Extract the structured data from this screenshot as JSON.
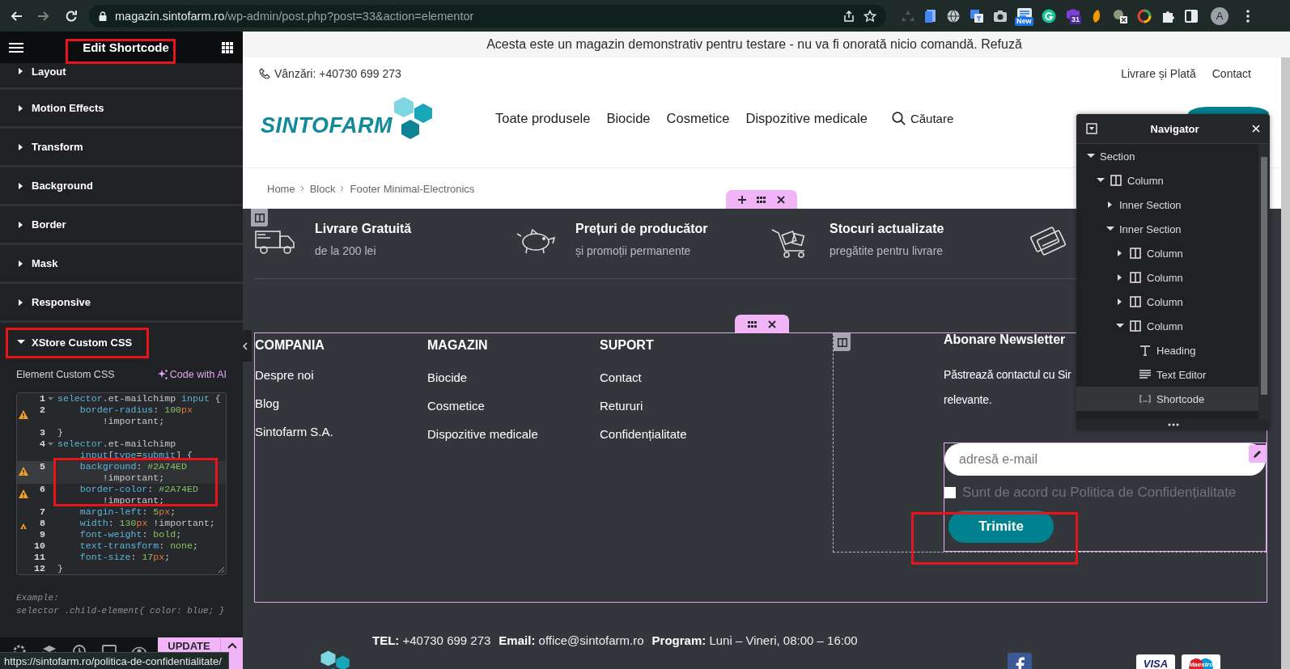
{
  "browser": {
    "url_host": "magazin.sintofarm.ro",
    "url_path": "/wp-admin/post.php?post=33&action=elementor",
    "new_badge": "New",
    "calendar_badge": "31",
    "profile_initial": "A"
  },
  "editor": {
    "title": "Edit Shortcode",
    "sections": [
      {
        "label": "Layout",
        "expanded": false
      },
      {
        "label": "Motion Effects",
        "expanded": false
      },
      {
        "label": "Transform",
        "expanded": false
      },
      {
        "label": "Background",
        "expanded": false
      },
      {
        "label": "Border",
        "expanded": false
      },
      {
        "label": "Mask",
        "expanded": false
      },
      {
        "label": "Responsive",
        "expanded": false
      },
      {
        "label": "XStore Custom CSS",
        "expanded": true
      }
    ],
    "custom_css": {
      "label": "Element Custom CSS",
      "ai_link": "Code with AI",
      "lines": [
        {
          "number": "1",
          "fold": true,
          "warning": false,
          "current": false,
          "rows": [
            "selector.et-mailchimp input {"
          ]
        },
        {
          "number": "2",
          "fold": false,
          "warning": true,
          "current": false,
          "rows": [
            "    border-radius: 100px",
            "        !important;"
          ]
        },
        {
          "number": "3",
          "fold": false,
          "warning": false,
          "current": false,
          "rows": [
            "}"
          ]
        },
        {
          "number": "4",
          "fold": true,
          "warning": false,
          "current": false,
          "rows": [
            "selector.et-mailchimp",
            "    input[type=submit] {"
          ]
        },
        {
          "number": "5",
          "fold": false,
          "warning": true,
          "current": true,
          "rows": [
            "    background: #2A74ED",
            "        !important;"
          ]
        },
        {
          "number": "6",
          "fold": false,
          "warning": true,
          "current": false,
          "rows": [
            "    border-color: #2A74ED",
            "        !important;"
          ]
        },
        {
          "number": "7",
          "fold": false,
          "warning": false,
          "current": false,
          "rows": [
            "    margin-left: 5px;"
          ]
        },
        {
          "number": "8",
          "fold": false,
          "warning": true,
          "current": false,
          "rows": [
            "    width: 130px !important;"
          ]
        },
        {
          "number": "9",
          "fold": false,
          "warning": false,
          "current": false,
          "rows": [
            "    font-weight: bold;"
          ]
        },
        {
          "number": "10",
          "fold": false,
          "warning": false,
          "current": false,
          "rows": [
            "    text-transform: none;"
          ]
        },
        {
          "number": "11",
          "fold": false,
          "warning": false,
          "current": false,
          "rows": [
            "    font-size: 17px;"
          ]
        },
        {
          "number": "12",
          "fold": false,
          "warning": false,
          "current": false,
          "rows": [
            "}"
          ]
        }
      ],
      "example_label": "Example:",
      "example_code": "selector .child-element{ color: blue; }"
    },
    "update_button": "UPDATE"
  },
  "site": {
    "notice": "Acesta este un magazin demonstrativ pentru testare - nu va fi onorată nicio comandă. Refuză",
    "phone": "Vânzări: +40730 699 273",
    "top_links": [
      "Livrare și Plată",
      "Contact"
    ],
    "logo_text": "SINTOFARM",
    "menu": [
      "Toate produsele",
      "Biocide",
      "Cosmetice",
      "Dispozitive medicale"
    ],
    "search_label": "Căutare",
    "breadcrumb": [
      "Home",
      "Block",
      "Footer Minimal-Electronics"
    ],
    "features": [
      {
        "kind": "truck",
        "title": "Livrare Gratuită",
        "subtitle": "de la 200 lei"
      },
      {
        "kind": "piggy",
        "title": "Prețuri de producător",
        "subtitle": "și promoții permanente"
      },
      {
        "kind": "cart",
        "title": "Stocuri actualizate",
        "subtitle": "pregătite pentru livrare"
      },
      {
        "kind": "cards"
      }
    ],
    "link_columns": [
      {
        "heading": "COMPANIA",
        "links": [
          "Despre noi",
          "Blog",
          "Sintofarm S.A."
        ]
      },
      {
        "heading": "MAGAZIN",
        "links": [
          "Biocide",
          "Cosmetice",
          "Dispozitive medicale"
        ]
      },
      {
        "heading": "SUPORT",
        "links": [
          "Contact",
          "Retururi",
          "Confidențialitate"
        ]
      }
    ],
    "newsletter": {
      "heading": "Abonare Newsletter",
      "text_lines": [
        "Păstrează contactul cu Sir",
        "relevante."
      ],
      "email_placeholder": "adresă e-mail",
      "consent": {
        "label": "Sunt de acord cu Politica de Confidențialitate",
        "checked": false
      },
      "submit": "Trimite"
    },
    "contact": [
      "**TEL:** +40730 699 273",
      "**Email:** office@sintofarm.ro",
      "**Program:** Luni – Vineri, 08:00 – 16:00"
    ],
    "payment_cards": [
      "VISA",
      "Maestro"
    ]
  },
  "navigator": {
    "title": "Navigator",
    "tree": [
      {
        "kind": "section",
        "label": "Section",
        "expanded": true,
        "selected": false,
        "children": [
          {
            "kind": "column",
            "label": "Column",
            "expanded": true,
            "selected": false,
            "children": [
              {
                "kind": "inner_section",
                "label": "Inner Section",
                "expanded": false,
                "selected": false
              },
              {
                "kind": "inner_section",
                "label": "Inner Section",
                "expanded": true,
                "selected": false,
                "children": [
                  {
                    "kind": "column",
                    "label": "Column",
                    "expanded": false,
                    "selected": false
                  },
                  {
                    "kind": "column",
                    "label": "Column",
                    "expanded": false,
                    "selected": false
                  },
                  {
                    "kind": "column",
                    "label": "Column",
                    "expanded": false,
                    "selected": false
                  },
                  {
                    "kind": "column",
                    "label": "Column",
                    "expanded": true,
                    "selected": false,
                    "children": [
                      {
                        "kind": "heading",
                        "label": "Heading",
                        "selected": false
                      },
                      {
                        "kind": "text_editor",
                        "label": "Text Editor",
                        "selected": false
                      },
                      {
                        "kind": "shortcode",
                        "label": "Shortcode",
                        "selected": true
                      }
                    ]
                  }
                ]
              }
            ]
          }
        ]
      }
    ]
  },
  "status_url": "https://sintofarm.ro/politica-de-confidentialitate/"
}
